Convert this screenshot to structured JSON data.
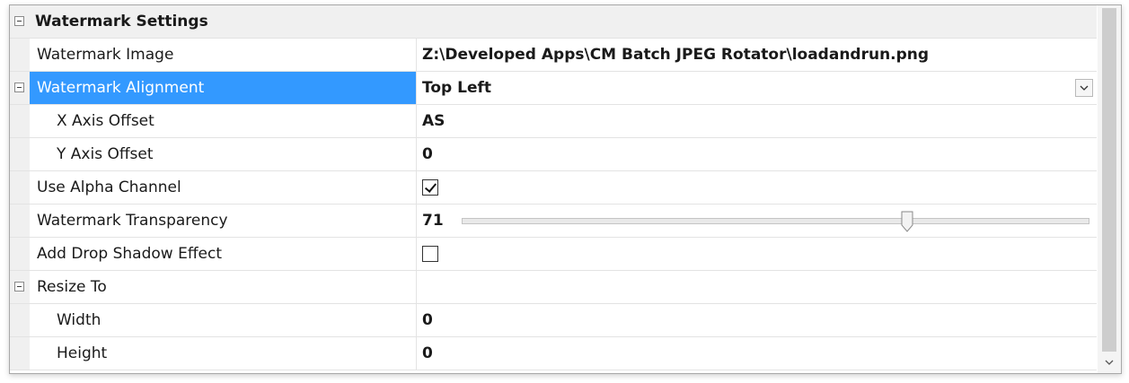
{
  "category": {
    "title": "Watermark Settings"
  },
  "rows": [
    {
      "name": "Watermark Image",
      "value": "Z:\\Developed Apps\\CM Batch JPEG Rotator\\loadandrun.png"
    },
    {
      "name": "Watermark Alignment",
      "value": "Top Left"
    },
    {
      "name": "X Axis Offset",
      "value": "AS"
    },
    {
      "name": "Y Axis Offset",
      "value": "0"
    },
    {
      "name": "Use Alpha Channel",
      "checked": true
    },
    {
      "name": "Watermark Transparency",
      "value": "71",
      "slider_fraction": 0.71
    },
    {
      "name": "Add Drop Shadow Effect",
      "checked": false
    },
    {
      "name": "Resize To",
      "value": ""
    },
    {
      "name": "Width",
      "value": "0"
    },
    {
      "name": "Height",
      "value": "0"
    }
  ],
  "icons": {
    "expander": "collapse-minus-icon",
    "dropdown": "chevron-down-icon",
    "scroll_down": "chevron-down-icon"
  },
  "colors": {
    "selection": "#3399ff",
    "category_bg": "#f0f0f0"
  }
}
